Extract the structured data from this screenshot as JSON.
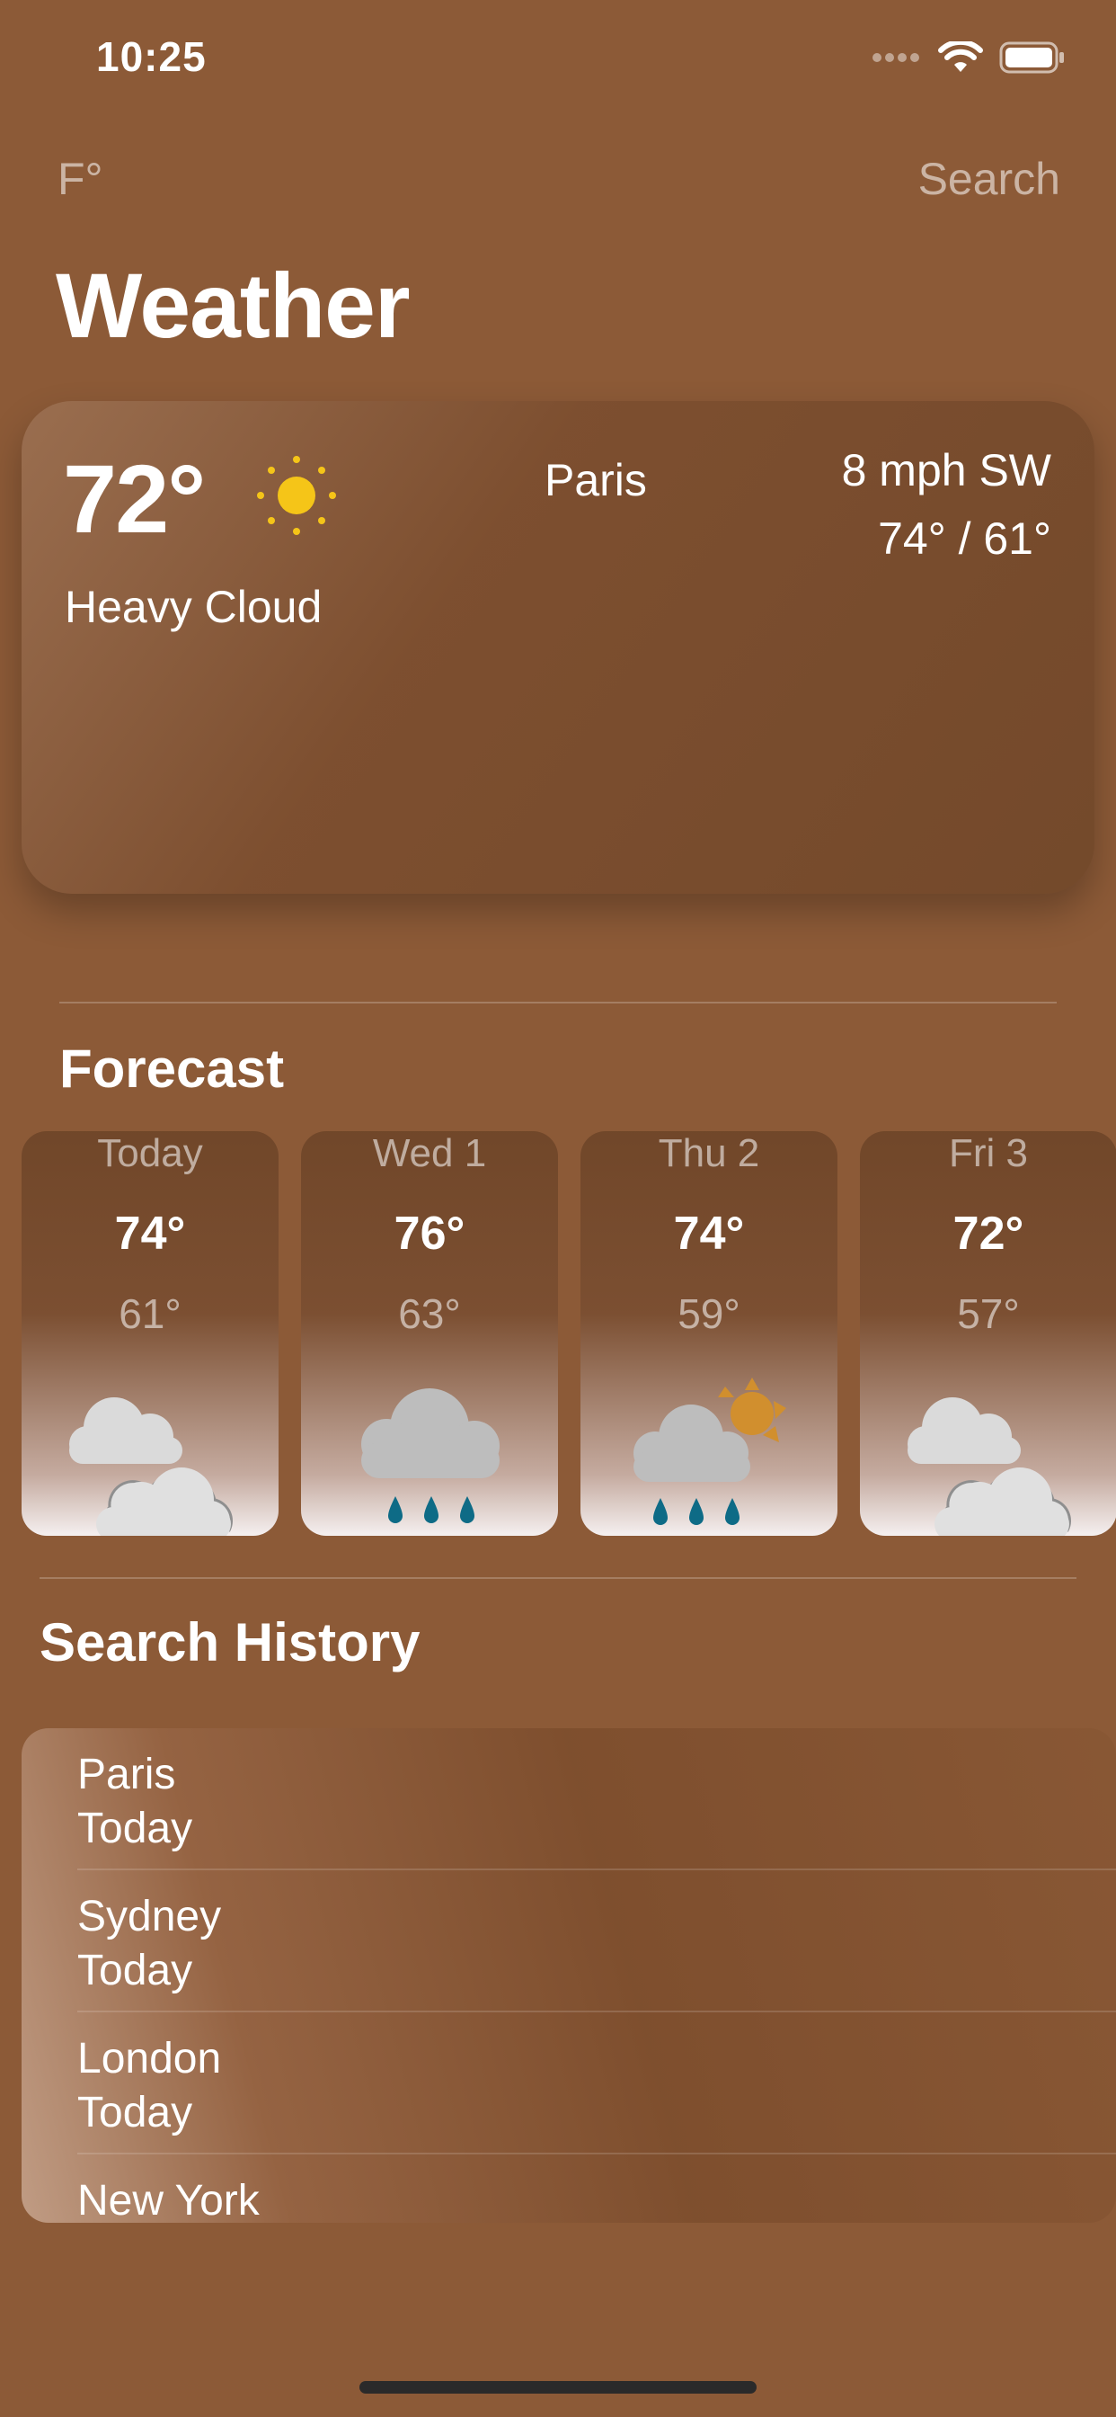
{
  "status_bar": {
    "time": "10:25"
  },
  "nav": {
    "unit_toggle": "F°",
    "search_button": "Search"
  },
  "title": "Weather",
  "current": {
    "temperature": "72°",
    "condition": "Heavy Cloud",
    "city": "Paris",
    "wind": "8 mph SW",
    "high_low": "74° / 61°",
    "icon": "sun-icon"
  },
  "forecast": {
    "title": "Forecast",
    "days": [
      {
        "day": "Today",
        "high": "74°",
        "low": "61°",
        "icon": "light-cloud-icon"
      },
      {
        "day": "Wed 1",
        "high": "76°",
        "low": "63°",
        "icon": "heavy-rain-icon"
      },
      {
        "day": "Thu 2",
        "high": "74°",
        "low": "59°",
        "icon": "showers-icon"
      },
      {
        "day": "Fri 3",
        "high": "72°",
        "low": "57°",
        "icon": "light-cloud-icon"
      }
    ]
  },
  "history": {
    "title": "Search History",
    "items": [
      {
        "city": "Paris",
        "date": "Today"
      },
      {
        "city": "Sydney",
        "date": "Today"
      },
      {
        "city": "London",
        "date": "Today"
      },
      {
        "city": "New York",
        "date": ""
      }
    ]
  },
  "colors": {
    "background": "#8c5a37",
    "sun": "#f5c518",
    "raindrop": "#0e6b86",
    "cloud": "#dcdcdc",
    "heavy_cloud": "#bdbdbd",
    "partial_sun": "#d18f2e"
  }
}
